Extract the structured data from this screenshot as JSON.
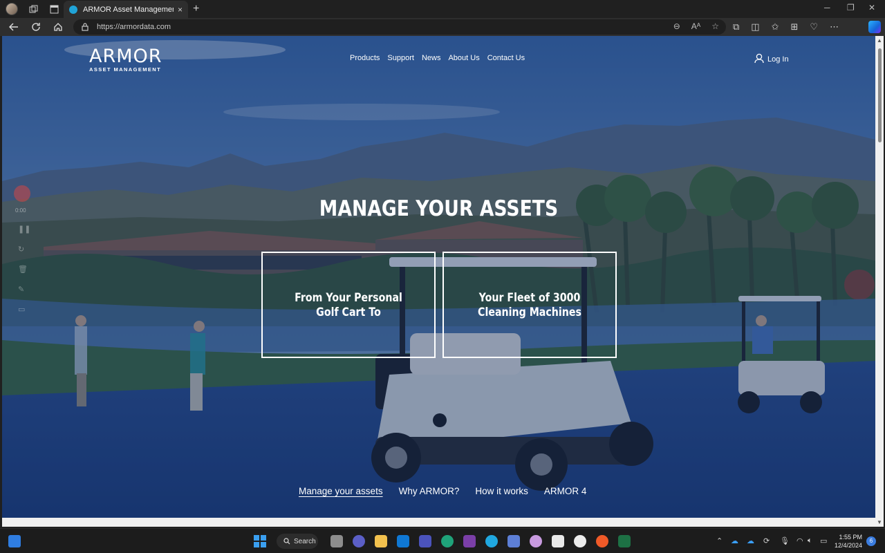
{
  "browser": {
    "tab_title": "ARMOR Asset Management",
    "url": "https://armordata.com",
    "new_tab_glyph": "+",
    "tab_close_glyph": "×",
    "icons": [
      "back-icon",
      "refresh-icon",
      "home-icon",
      "lock-icon",
      "zoom-icon",
      "read-aloud-icon",
      "favorite-star-icon",
      "extensions-icon",
      "split-screen-icon",
      "favorites-icon",
      "collections-icon",
      "performance-icon",
      "more-icon",
      "copilot-icon"
    ]
  },
  "site": {
    "logo_word": "ARMOR",
    "logo_sub": "ASSET MANAGEMENT",
    "nav": [
      "Products",
      "Support",
      "News",
      "About Us",
      "Contact Us"
    ],
    "login_label": "Log In",
    "hero_title": "MANAGE YOUR ASSETS",
    "cards": [
      {
        "label": "From Your Personal Golf Cart To"
      },
      {
        "label": "Your Fleet of 3000 Cleaning Machines"
      }
    ],
    "subnav": [
      {
        "label": "Manage your assets",
        "active": true
      },
      {
        "label": "Why ARMOR?",
        "active": false
      },
      {
        "label": "How it works",
        "active": false
      },
      {
        "label": "ARMOR 4",
        "active": false
      }
    ]
  },
  "recorder": {
    "time": "0:00"
  },
  "taskbar": {
    "search_label": "Search",
    "time": "1:55 PM",
    "date": "12/4/2024",
    "notification_count": "6"
  },
  "colors": {
    "chrome_dark": "#202020",
    "toolbar": "#2e2e2e",
    "accent": "#20a4d8",
    "hero_overlay": "#2c4c86"
  }
}
